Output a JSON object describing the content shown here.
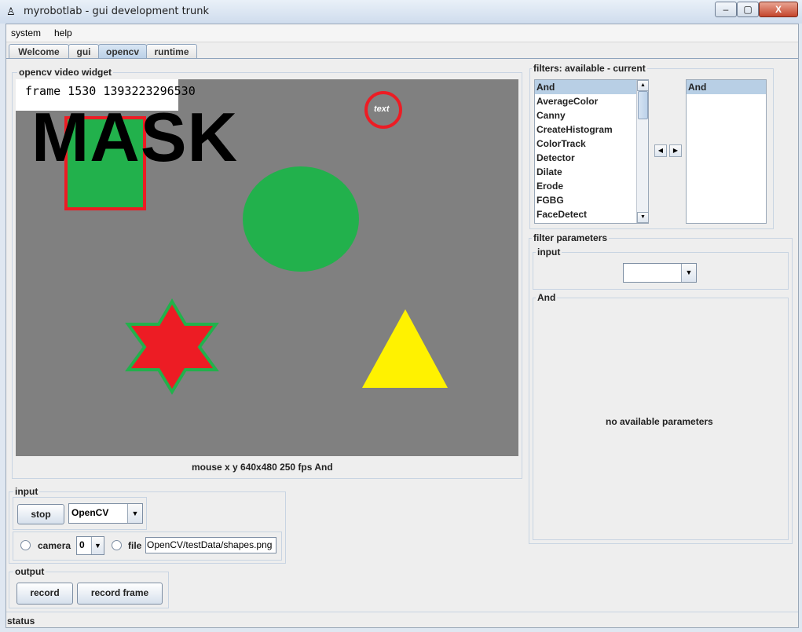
{
  "window": {
    "title": "myrobotlab - gui development trunk",
    "icon": "robot-app-icon",
    "controls": {
      "minimize": "–",
      "maximize": "▢",
      "close": "X"
    }
  },
  "menu": {
    "items": [
      "system",
      "help"
    ]
  },
  "tabs": [
    {
      "label": "Welcome",
      "active": false
    },
    {
      "label": "gui",
      "active": false
    },
    {
      "label": "opencv",
      "active": true
    },
    {
      "label": "runtime",
      "active": false
    }
  ],
  "video_widget": {
    "title": "opencv  video widget",
    "frame_text": "frame 1530 1393223296530",
    "mask_text": "MASK",
    "overlay_text": "text",
    "status": "mouse x y  640x480  250 fps  And"
  },
  "input": {
    "title": "input",
    "stop_label": "stop",
    "grabber": "OpenCV",
    "camera_label": "camera",
    "camera_index": "0",
    "file_label": "file",
    "file_value": "OpenCV/testData/shapes.png"
  },
  "output": {
    "title": "output",
    "record_label": "record",
    "record_frame_label": "record frame"
  },
  "filters": {
    "title": "filters: available - current",
    "available": [
      "And",
      "AverageColor",
      "Canny",
      "CreateHistogram",
      "ColorTrack",
      "Detector",
      "Dilate",
      "Erode",
      "FGBG",
      "FaceDetect"
    ],
    "selected_available": "And",
    "current": [
      "And"
    ]
  },
  "filter_parameters": {
    "title": "filter parameters",
    "input_title": "input",
    "input_value": "",
    "filter_name": "And",
    "empty_message": "no available parameters"
  },
  "status": {
    "label": "status"
  },
  "colors": {
    "gray_background": "#808080",
    "green": "#22b14c",
    "red": "#ed1c24",
    "yellow": "#fff200"
  }
}
